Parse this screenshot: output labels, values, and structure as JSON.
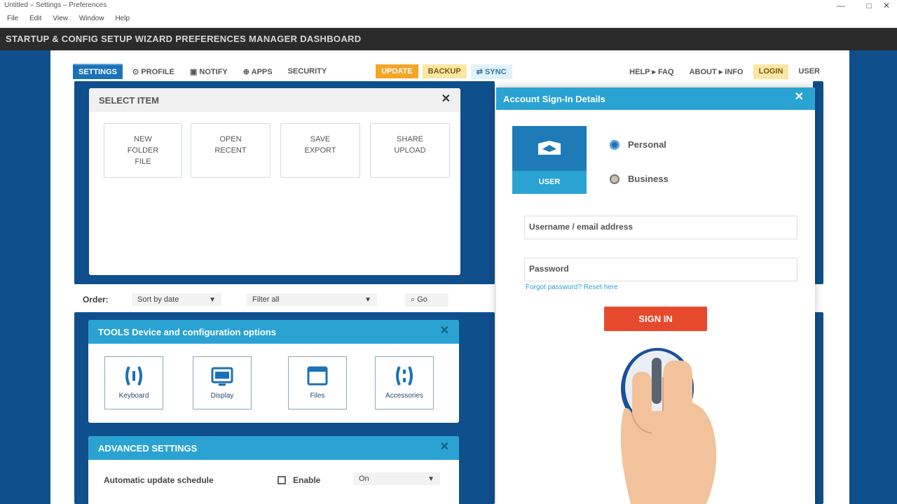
{
  "titlebar": {
    "title": "Untitled – Settings – Preferences",
    "minimize": "—",
    "maximize": "□",
    "close": "✕"
  },
  "menubar": {
    "items": [
      "File",
      "Edit",
      "View",
      "Window",
      "Help"
    ]
  },
  "toolbar": {
    "text": "STARTUP  &  CONFIG  SETUP  WIZARD  PREFERENCES  MANAGER  DASHBOARD"
  },
  "tabs": {
    "left": [
      {
        "label": "SETTINGS",
        "style": "active"
      },
      {
        "label": "⊙ PROFILE",
        "style": "plain"
      },
      {
        "label": "▣ NOTIFY",
        "style": "plain"
      },
      {
        "label": "⊕ APPS",
        "style": "plain"
      },
      {
        "label": "SECURITY",
        "style": "plain"
      },
      {
        "label": "UPDATE",
        "style": "orange"
      },
      {
        "label": "BACKUP",
        "style": "yellow"
      },
      {
        "label": "⇄ SYNC",
        "style": "teal"
      }
    ],
    "right": [
      {
        "label": "HELP  ▸  FAQ",
        "style": "plain"
      },
      {
        "label": "ABOUT ▸ INFO",
        "style": "plain"
      },
      {
        "label": "LOGIN",
        "style": "yellow"
      },
      {
        "label": "USER",
        "style": "plain"
      }
    ]
  },
  "top_panel": {
    "title": "SELECT  ITEM",
    "close": "✕",
    "tiles": [
      {
        "line1": "NEW",
        "line2": "FOLDER",
        "line3": "FILE"
      },
      {
        "line1": "OPEN",
        "line2": "RECENT",
        "line3": ""
      },
      {
        "line1": "SAVE",
        "line2": "EXPORT",
        "line3": ""
      },
      {
        "line1": "SHARE",
        "line2": "UPLOAD",
        "line3": ""
      }
    ]
  },
  "filter_row": {
    "label": "Order:",
    "select1": "Sort by date",
    "select2": "Filter all",
    "search_label": "⌕ Go"
  },
  "mid_panel": {
    "title": "TOOLS    Device and configuration options",
    "close": "✕",
    "tiles": [
      {
        "label": "Keyboard",
        "icon": "bracket-icon"
      },
      {
        "label": "Display",
        "icon": "monitor-icon"
      },
      {
        "label": "Files",
        "icon": "window-icon"
      },
      {
        "label": "Accessories",
        "icon": "bracket-icon"
      }
    ]
  },
  "bottom_panel": {
    "title": "ADVANCED  SETTINGS",
    "close": "✕",
    "row_label": "Automatic update schedule",
    "option_label": "Enable",
    "select": "On"
  },
  "right_panel": {
    "title": "Account Sign-In Details",
    "close": "✕",
    "card_label": "USER",
    "radio1": "Personal",
    "radio2": "Business",
    "field1": "Username / email address",
    "field2": "Password",
    "hint": "Forgot password?  Reset here",
    "button": "SIGN IN",
    "colors": {
      "accent": "#2aa3d3",
      "button": "#e64a2e",
      "frame": "#0e4f8c"
    }
  }
}
